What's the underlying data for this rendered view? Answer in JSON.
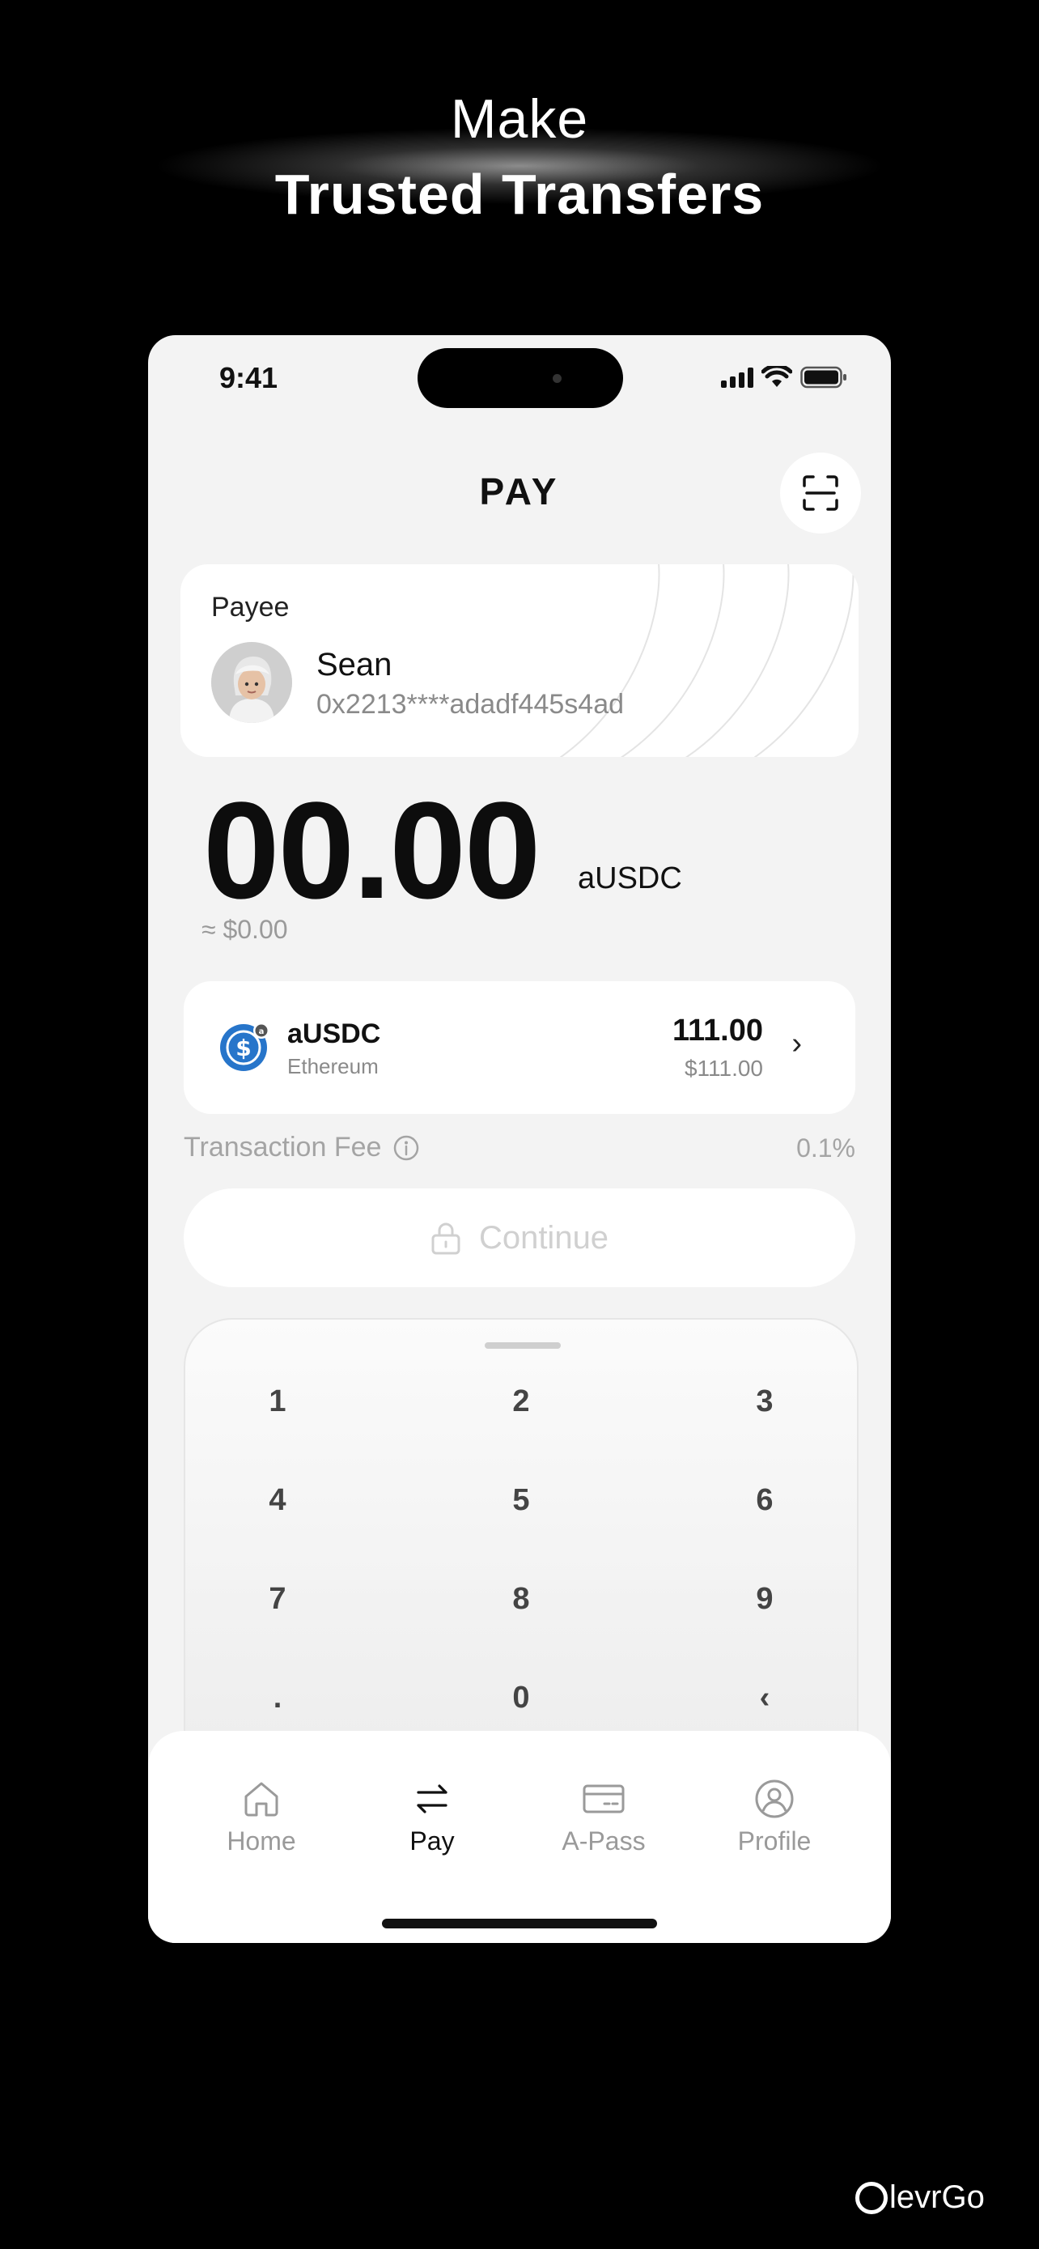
{
  "hero": {
    "line1": "Make",
    "line2": "Trusted Transfers"
  },
  "status_bar": {
    "time": "9:41"
  },
  "header": {
    "title": "PAY",
    "scan_icon": "scan-qr-icon"
  },
  "payee": {
    "label": "Payee",
    "name": "Sean",
    "address": "0x2213****adadf445s4ad"
  },
  "amount": {
    "value": "00.00",
    "unit": "aUSDC",
    "usd": "≈ $0.00"
  },
  "token": {
    "symbol": "aUSDC",
    "chain": "Ethereum",
    "balance": "111.00",
    "balance_usd": "$111.00",
    "chevron": "›",
    "icon": "usdc-coin-icon"
  },
  "fee": {
    "label": "Transaction Fee",
    "value": "0.1%",
    "icon": "info-icon"
  },
  "continue": {
    "label": "Continue",
    "icon": "lock-icon"
  },
  "keypad": {
    "keys": [
      "1",
      "2",
      "3",
      "4",
      "5",
      "6",
      "7",
      "8",
      "9",
      ".",
      "0",
      "‹"
    ]
  },
  "tabbar": {
    "tabs": [
      {
        "label": "Home",
        "icon": "home-icon",
        "active": false
      },
      {
        "label": "Pay",
        "icon": "transfer-arrows-icon",
        "active": true
      },
      {
        "label": "A-Pass",
        "icon": "card-icon",
        "active": false
      },
      {
        "label": "Profile",
        "icon": "user-circle-icon",
        "active": false
      }
    ]
  },
  "brand": {
    "text": "levrGo"
  },
  "colors": {
    "usdc_blue": "#2775CA",
    "background": "#000000",
    "screen": "#F3F3F3"
  }
}
